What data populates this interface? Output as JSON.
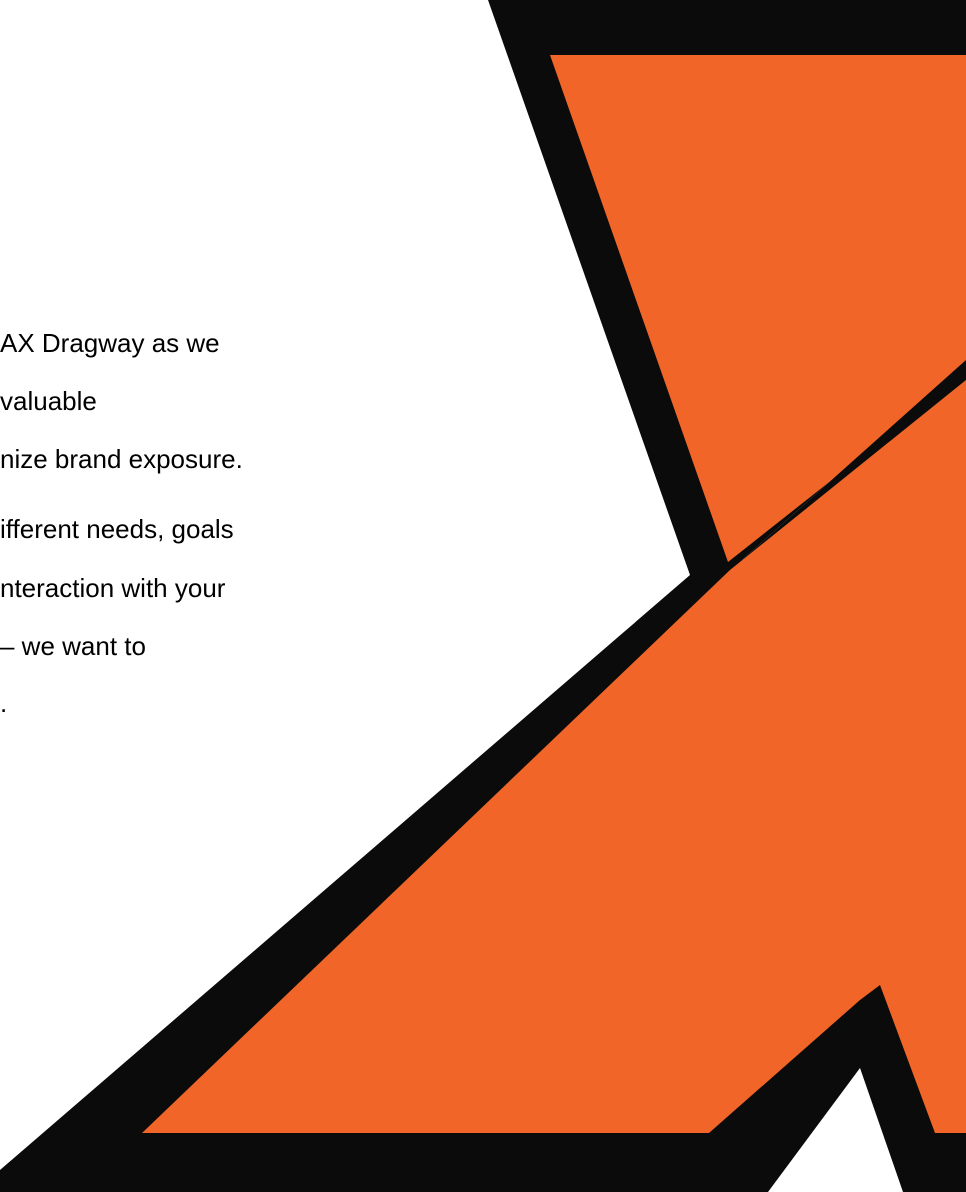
{
  "colors": {
    "accent_orange": "#F26528",
    "outline_black": "#0b0b0b",
    "background": "#ffffff"
  },
  "logo": {
    "icon": "x-logo-icon"
  },
  "paragraphs": [
    {
      "lines": [
        "AX Dragway as we",
        "valuable",
        "nize brand exposure."
      ]
    },
    {
      "lines": [
        "ifferent needs, goals",
        "nteraction with your",
        "– we want to",
        "."
      ]
    }
  ]
}
